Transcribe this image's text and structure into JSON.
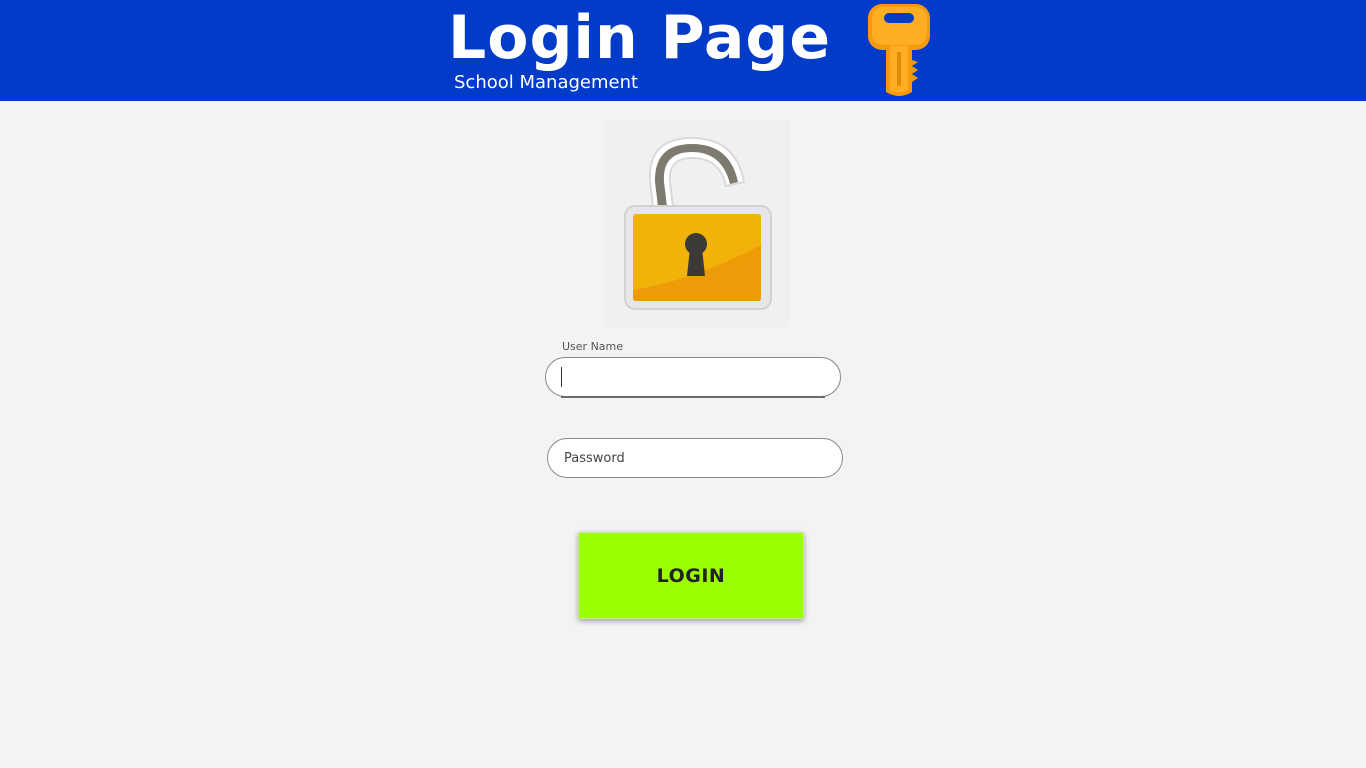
{
  "header": {
    "title": "Login Page",
    "subtitle": "School Management",
    "background_color": "#023bc7",
    "icon": "key-icon"
  },
  "main": {
    "image_icon": "padlock-open-icon",
    "username": {
      "label": "User Name",
      "value": ""
    },
    "password": {
      "placeholder": "Password",
      "value": ""
    },
    "login_button": {
      "label": "LOGIN",
      "color": "#9bff00"
    }
  }
}
